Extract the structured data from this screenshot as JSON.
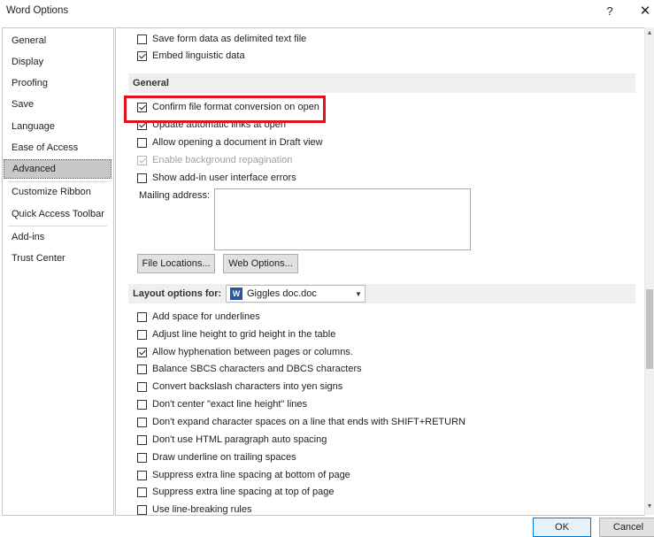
{
  "window": {
    "title": "Word Options",
    "help_label": "?",
    "close_label": "✕"
  },
  "nav": {
    "items": [
      {
        "label": "General"
      },
      {
        "label": "Display"
      },
      {
        "label": "Proofing"
      },
      {
        "label": "Save"
      },
      {
        "label": "Language"
      },
      {
        "label": "Ease of Access"
      },
      {
        "label": "Advanced",
        "selected": true
      },
      {
        "label": "Customize Ribbon"
      },
      {
        "label": "Quick Access Toolbar"
      },
      {
        "label": "Add-ins"
      },
      {
        "label": "Trust Center"
      }
    ]
  },
  "top_options": [
    {
      "label": "Save form data as delimited text file",
      "checked": false
    },
    {
      "label": "Embed linguistic data",
      "checked": true
    }
  ],
  "general": {
    "heading": "General",
    "options": [
      {
        "label": "Confirm file format conversion on open",
        "checked": true
      },
      {
        "label": "Update automatic links at open",
        "checked": true
      },
      {
        "label": "Allow opening a document in Draft view",
        "checked": false
      },
      {
        "label": "Enable background repagination",
        "checked": true,
        "disabled": true
      },
      {
        "label": "Show add-in user interface errors",
        "checked": false
      }
    ],
    "mailing_address_label": "Mailing address:",
    "mailing_address_value": "",
    "file_locations_label": "File Locations...",
    "web_options_label": "Web Options..."
  },
  "layout": {
    "heading": "Layout options for:",
    "document": "Giggles doc.doc",
    "doc_icon_letter": "W",
    "options": [
      {
        "label": "Add space for underlines",
        "checked": false
      },
      {
        "label": "Adjust line height to grid height in the table",
        "checked": false
      },
      {
        "label": "Allow hyphenation between pages or columns.",
        "checked": true
      },
      {
        "label": "Balance SBCS characters and DBCS characters",
        "checked": false
      },
      {
        "label": "Convert backslash characters into yen signs",
        "checked": false
      },
      {
        "label": "Don't center \"exact line height\" lines",
        "checked": false
      },
      {
        "label": "Don't expand character spaces on a line that ends with SHIFT+RETURN",
        "checked": false
      },
      {
        "label": "Don't use HTML paragraph auto spacing",
        "checked": false
      },
      {
        "label": "Draw underline on trailing spaces",
        "checked": false
      },
      {
        "label": "Suppress extra line spacing at bottom of page",
        "checked": false
      },
      {
        "label": "Suppress extra line spacing at top of page",
        "checked": false
      },
      {
        "label": "Use line-breaking rules",
        "checked": false
      }
    ]
  },
  "footer": {
    "ok_label": "OK",
    "cancel_label": "Cancel"
  },
  "colors": {
    "highlight": "#e0141e",
    "selected_nav": "#c8c8c8",
    "section_bg": "#efefef"
  }
}
